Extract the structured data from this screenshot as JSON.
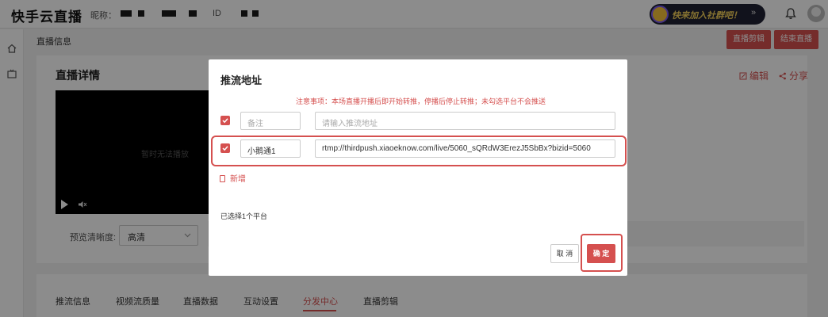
{
  "header": {
    "brand": "快手云直播",
    "nickname_label": "昵称：",
    "id_label": "ID",
    "promo_text": "快来加入社群吧！",
    "promo_arrow": "»"
  },
  "breadcrumb": "直播信息",
  "actions": {
    "clip_label": "直播剪辑",
    "end_label": "结束直播"
  },
  "detail": {
    "title": "直播详情",
    "edit_label": "编辑",
    "share_label": "分享",
    "video_status": "暂时无法播放",
    "preview_label": "预览清晰度:",
    "preview_value": "高清"
  },
  "tabs": [
    {
      "label": "推流信息"
    },
    {
      "label": "视频流质量"
    },
    {
      "label": "直播数据"
    },
    {
      "label": "互动设置"
    },
    {
      "label": "分发中心",
      "active": true
    },
    {
      "label": "直播剪辑"
    }
  ],
  "modal": {
    "title": "推流地址",
    "notice": "注意事项：本场直播开播后即开始转推，停播后停止转推；未勾选平台不会推送",
    "rows": [
      {
        "checked": true,
        "note_value": "",
        "note_placeholder": "备注",
        "url_value": "",
        "url_placeholder": "请输入推流地址"
      },
      {
        "checked": true,
        "note_value": "小鹅通1",
        "note_placeholder": "",
        "url_value": "rtmp://thirdpush.xiaoeknow.com/live/5060_sQRdW3ErezJ5SbBx?bizid=5060",
        "url_placeholder": ""
      }
    ],
    "add_label": "新增",
    "selected_text": "已选择1个平台",
    "cancel_label": "取 消",
    "confirm_label": "确 定"
  },
  "colors": {
    "accent": "#d5504f",
    "overlay": "rgba(0,0,0,0.45)"
  }
}
